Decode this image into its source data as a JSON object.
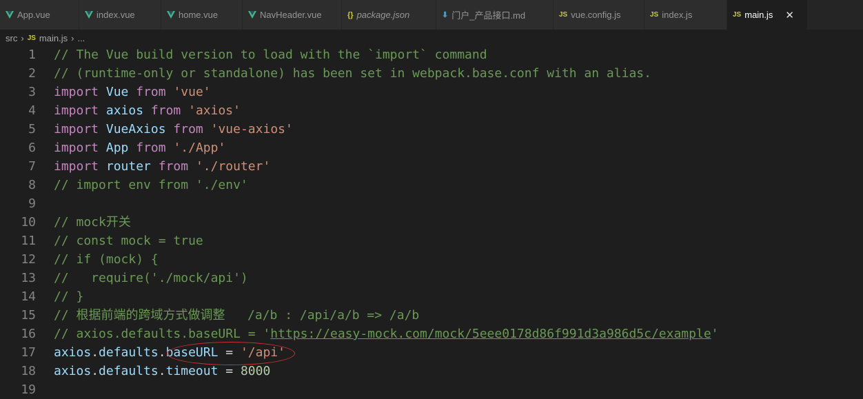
{
  "tabs": [
    {
      "label": "App.vue",
      "icon": "vue-icon"
    },
    {
      "label": "index.vue",
      "icon": "vue-icon"
    },
    {
      "label": "home.vue",
      "icon": "vue-icon"
    },
    {
      "label": "NavHeader.vue",
      "icon": "vue-icon"
    },
    {
      "label": "package.json",
      "icon": "json-icon",
      "icon_text": "{}"
    },
    {
      "label": "门户_产品接口.md",
      "icon": "markdown-icon",
      "icon_text": "⬇"
    },
    {
      "label": "vue.config.js",
      "icon": "js-icon",
      "icon_text": "JS"
    },
    {
      "label": "index.js",
      "icon": "js-icon",
      "icon_text": "JS"
    },
    {
      "label": "main.js",
      "icon": "js-icon",
      "icon_text": "JS",
      "close": "✕"
    }
  ],
  "breadcrumb": {
    "folder": "src",
    "file_icon": "JS",
    "file": "main.js",
    "more": "..."
  },
  "colors": {
    "comment": "#6a9955",
    "keyword": "#c586c0",
    "variable": "#9cdcfe",
    "string": "#ce9178",
    "number": "#b5cea8",
    "annotation": "#d03030"
  },
  "lines": [
    {
      "no": "1",
      "tokens": [
        [
          "c",
          "// The Vue build version to load with the `import` command"
        ]
      ]
    },
    {
      "no": "2",
      "tokens": [
        [
          "c",
          "// (runtime-only or standalone) has been set in webpack.base.conf with an alias."
        ]
      ]
    },
    {
      "no": "3",
      "tokens": [
        [
          "k",
          "import"
        ],
        [
          "o",
          " "
        ],
        [
          "v",
          "Vue"
        ],
        [
          "o",
          " "
        ],
        [
          "k",
          "from"
        ],
        [
          "o",
          " "
        ],
        [
          "s",
          "'vue'"
        ]
      ]
    },
    {
      "no": "4",
      "tokens": [
        [
          "k",
          "import"
        ],
        [
          "o",
          " "
        ],
        [
          "v",
          "axios"
        ],
        [
          "o",
          " "
        ],
        [
          "k",
          "from"
        ],
        [
          "o",
          " "
        ],
        [
          "s",
          "'axios'"
        ]
      ]
    },
    {
      "no": "5",
      "tokens": [
        [
          "k",
          "import"
        ],
        [
          "o",
          " "
        ],
        [
          "v",
          "VueAxios"
        ],
        [
          "o",
          " "
        ],
        [
          "k",
          "from"
        ],
        [
          "o",
          " "
        ],
        [
          "s",
          "'vue-axios'"
        ]
      ]
    },
    {
      "no": "6",
      "tokens": [
        [
          "k",
          "import"
        ],
        [
          "o",
          " "
        ],
        [
          "v",
          "App"
        ],
        [
          "o",
          " "
        ],
        [
          "k",
          "from"
        ],
        [
          "o",
          " "
        ],
        [
          "s",
          "'./App'"
        ]
      ]
    },
    {
      "no": "7",
      "tokens": [
        [
          "k",
          "import"
        ],
        [
          "o",
          " "
        ],
        [
          "v",
          "router"
        ],
        [
          "o",
          " "
        ],
        [
          "k",
          "from"
        ],
        [
          "o",
          " "
        ],
        [
          "s",
          "'./router'"
        ]
      ]
    },
    {
      "no": "8",
      "tokens": [
        [
          "c",
          "// import env from './env'"
        ]
      ]
    },
    {
      "no": "9",
      "tokens": []
    },
    {
      "no": "10",
      "tokens": [
        [
          "c",
          "// mock开关"
        ]
      ]
    },
    {
      "no": "11",
      "tokens": [
        [
          "c",
          "// const mock = true"
        ]
      ]
    },
    {
      "no": "12",
      "tokens": [
        [
          "c",
          "// if (mock) {"
        ]
      ]
    },
    {
      "no": "13",
      "tokens": [
        [
          "c",
          "//   require('./mock/api')"
        ]
      ]
    },
    {
      "no": "14",
      "tokens": [
        [
          "c",
          "// }"
        ]
      ]
    },
    {
      "no": "15",
      "tokens": [
        [
          "c",
          "// 根据前端的跨域方式做调整   /a/b : /api/a/b => /a/b"
        ]
      ]
    },
    {
      "no": "16",
      "tokens": [
        [
          "c",
          "// axios.defaults.baseURL = '"
        ],
        [
          "cu",
          "https://easy-mock.com/mock/5eee0178d86f991d3a986d5c/example"
        ],
        [
          "c",
          "'"
        ]
      ]
    },
    {
      "no": "17",
      "tokens": [
        [
          "v",
          "axios"
        ],
        [
          "o",
          "."
        ],
        [
          "v",
          "defaults"
        ],
        [
          "o",
          "."
        ],
        [
          "v",
          "baseURL"
        ],
        [
          "o",
          " = "
        ],
        [
          "s",
          "'/api'"
        ]
      ]
    },
    {
      "no": "18",
      "tokens": [
        [
          "v",
          "axios"
        ],
        [
          "o",
          "."
        ],
        [
          "v",
          "defaults"
        ],
        [
          "o",
          "."
        ],
        [
          "v",
          "timeout"
        ],
        [
          "o",
          " = "
        ],
        [
          "n",
          "8000"
        ]
      ]
    },
    {
      "no": "19",
      "tokens": []
    }
  ]
}
